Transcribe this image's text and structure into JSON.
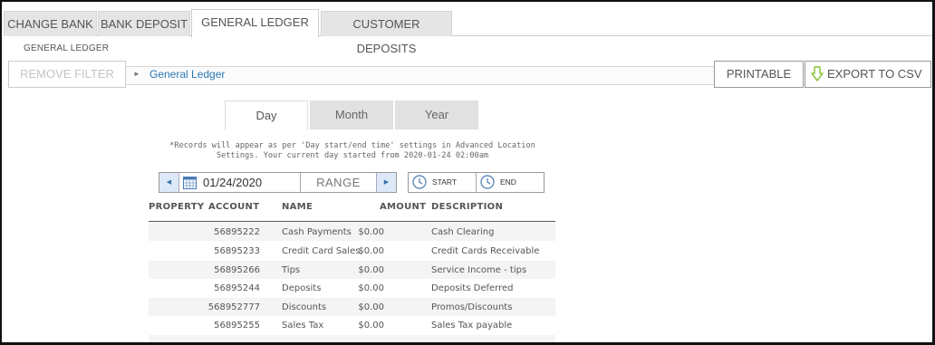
{
  "tabs": [
    {
      "label": "CHANGE BANK",
      "active": false
    },
    {
      "label": "BANK DEPOSIT",
      "active": false
    },
    {
      "label": "GENERAL LEDGER",
      "active": true
    },
    {
      "label": "CUSTOMER DEPOSITS",
      "active": false
    }
  ],
  "page_title": "GENERAL LEDGER",
  "toolbar": {
    "remove_filter": "REMOVE FILTER",
    "breadcrumb": "General Ledger",
    "printable": "PRINTABLE",
    "export_csv": "EXPORT TO CSV"
  },
  "period_tabs": [
    {
      "label": "Day",
      "active": true
    },
    {
      "label": "Month",
      "active": false
    },
    {
      "label": "Year",
      "active": false
    }
  ],
  "note": "*Records will appear as per 'Day start/end time' settings in Advanced Location Settings. Your current day started from 2020-01-24 02:00am",
  "date_control": {
    "date": "01/24/2020",
    "range_label": "RANGE",
    "start_label": "START",
    "end_label": "END"
  },
  "table": {
    "headers": {
      "property": "PROPERTY",
      "account": "ACCOUNT",
      "name": "NAME",
      "amount": "AMOUNT",
      "description": "DESCRIPTION"
    },
    "rows": [
      {
        "account": "56895222",
        "name": "Cash Payments",
        "amount": "$0.00",
        "description": "Cash Clearing"
      },
      {
        "account": "56895233",
        "name": "Credit Card Sales",
        "amount": "$0.00",
        "description": "Credit Cards Receivable"
      },
      {
        "account": "56895266",
        "name": "Tips",
        "amount": "$0.00",
        "description": "Service Income - tips"
      },
      {
        "account": "56895244",
        "name": "Deposits",
        "amount": "$0.00",
        "description": "Deposits Deferred"
      },
      {
        "account": "568952777",
        "name": "Discounts",
        "amount": "$0.00",
        "description": "Promos/Discounts"
      },
      {
        "account": "56895255",
        "name": "Sales Tax",
        "amount": "$0.00",
        "description": "Sales Tax payable"
      }
    ]
  },
  "colors": {
    "link": "#2b78b6",
    "tab_inactive": "#e5e5e5",
    "export_icon": "#8cc63f",
    "nav_accent": "#3a6fb0"
  }
}
